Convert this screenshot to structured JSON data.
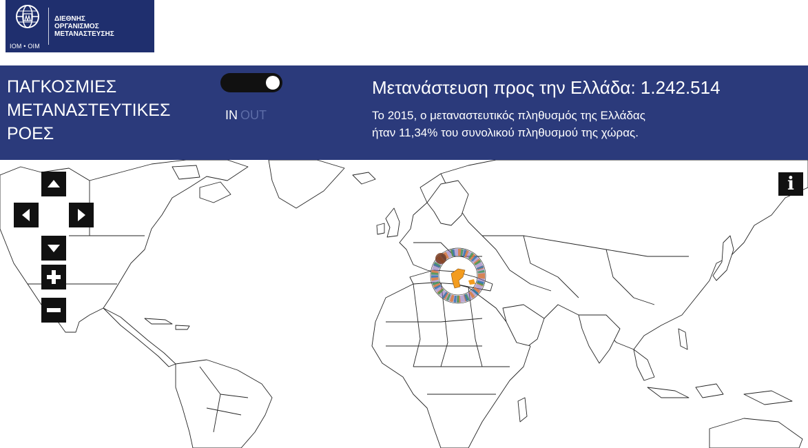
{
  "logo": {
    "abbr": "IOM • OIM",
    "name_lines": [
      "ΔΙΕΘΝΗΣ",
      "ΟΡΓΑΝΙΣΜΟΣ",
      "ΜΕΤΑΝΑΣΤΕΥΣΗΣ"
    ],
    "icon": "globe-figures-icon"
  },
  "header": {
    "title_lines": [
      "ΠΑΓΚΟΣΜΙΕΣ",
      "ΜΕΤΑΝΑΣΤΕΥΤΙΚΕΣ",
      "ΡΟΕΣ"
    ],
    "toggle": {
      "in_label": "IN",
      "out_label": "OUT",
      "selected": "IN"
    },
    "headline": "Μετανάστευση προς την Ελλάδα: 1.242.514",
    "subtext_lines": [
      "Το 2015, ο μεταναστευτικός πληθυσμός της Ελλάδας",
      "ήταν 11,34% του συνολικού πληθυσμού της χώρας."
    ]
  },
  "map": {
    "controls": {
      "pan_up_icon": "arrow-up-icon",
      "pan_left_icon": "arrow-left-icon",
      "pan_right_icon": "arrow-right-icon",
      "pan_down_icon": "arrow-down-icon",
      "zoom_in_icon": "plus-icon",
      "zoom_out_icon": "minus-icon"
    },
    "info_label": "i",
    "highlighted_country": "Ελλάδα"
  },
  "colors": {
    "banner": "#2b3a7b",
    "logo_bg": "#1f2f6e",
    "toggle_out": "#5d6da8",
    "greece": "#f39c1f"
  }
}
